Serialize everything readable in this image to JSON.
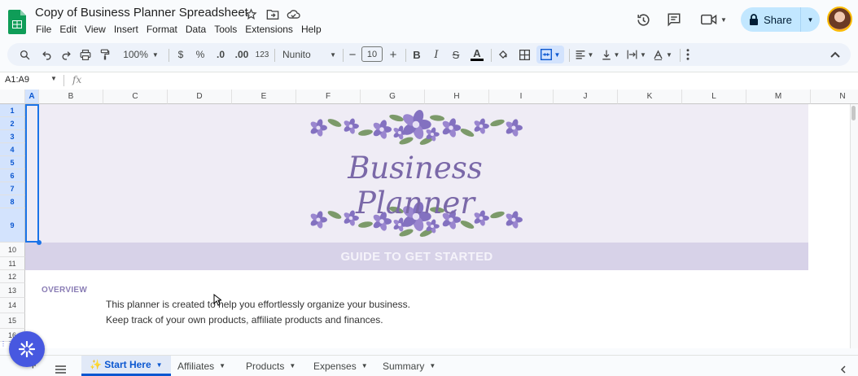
{
  "document": {
    "title": "Copy of Business Planner Spreadsheet"
  },
  "menu": [
    "File",
    "Edit",
    "View",
    "Insert",
    "Format",
    "Data",
    "Tools",
    "Extensions",
    "Help"
  ],
  "header": {
    "share_label": "Share"
  },
  "toolbar": {
    "zoom": "100%",
    "currency": "$",
    "percent": "%",
    "dec_decrease": ".0",
    "dec_increase": ".00",
    "format_more": "123",
    "font": "Nunito",
    "font_size": "10",
    "minus": "−",
    "plus": "+",
    "bold": "B",
    "italic": "I",
    "strike": "S",
    "text_color": "A"
  },
  "formula_bar": {
    "name_box": "A1:A9",
    "fx": "fx",
    "formula": ""
  },
  "grid": {
    "columns": [
      "A",
      "B",
      "C",
      "D",
      "E",
      "F",
      "G",
      "H",
      "I",
      "J",
      "K",
      "L",
      "M",
      "N"
    ],
    "rows": [
      "1",
      "2",
      "3",
      "4",
      "5",
      "6",
      "7",
      "8",
      "9",
      "10",
      "11",
      "12",
      "13",
      "14",
      "15",
      "16"
    ],
    "selected_range": "A1:A9"
  },
  "content": {
    "banner_title": "Business Planner",
    "guide_heading": "GUIDE TO GET STARTED",
    "overview_label": "OVERVIEW",
    "line1": "This planner is created to help you effortlessly organize your business.",
    "line2": "Keep track of your own products, affiliate products and finances."
  },
  "sheets": [
    {
      "name": "✨ Start Here",
      "active": true
    },
    {
      "name": "Affiliates",
      "active": false
    },
    {
      "name": "Products",
      "active": false
    },
    {
      "name": "Expenses",
      "active": false
    },
    {
      "name": "Summary",
      "active": false
    }
  ],
  "colors": {
    "banner_bg": "#efecf5",
    "guide_bg": "#d7d2e8",
    "accent_purple": "#7a68a8",
    "share_bg": "#c2e7ff",
    "selection": "#1a73e8"
  }
}
